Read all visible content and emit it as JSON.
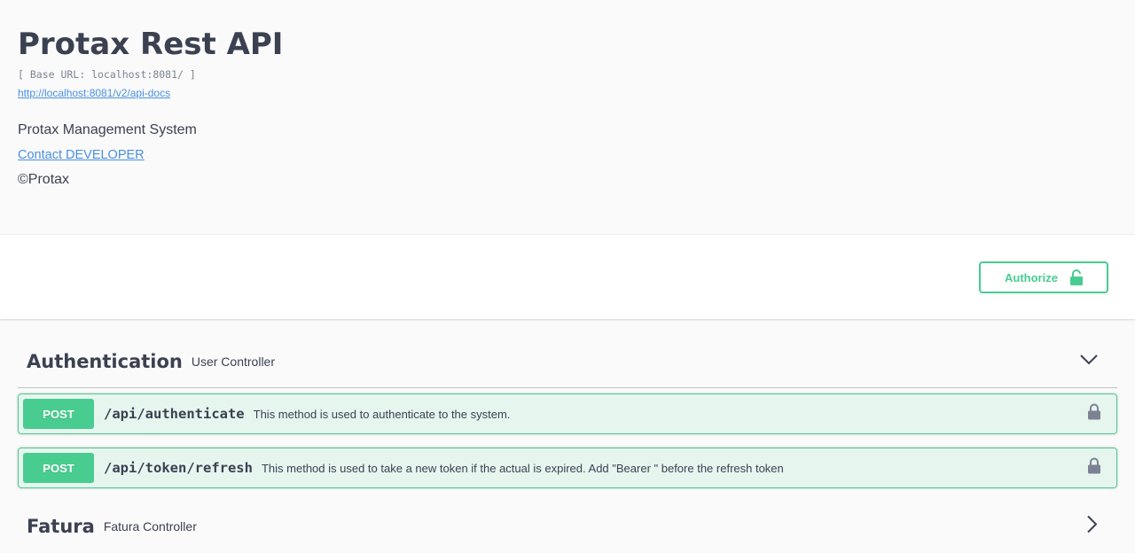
{
  "info": {
    "title": "Protax Rest API",
    "base_url": "[ Base URL: localhost:8081/ ]",
    "docs_link": "http://localhost:8081/v2/api-docs",
    "description": "Protax Management System",
    "contact_link": "Contact DEVELOPER",
    "copyright": "©Protax"
  },
  "scheme_bar": {
    "authorize_label": "Authorize",
    "authorize_icon": "unlocked-padlock-icon"
  },
  "colors": {
    "post_green": "#49cc90",
    "link_blue": "#4990e2",
    "text_dark": "#3b4151"
  },
  "tags": [
    {
      "name": "Authentication",
      "description": "User Controller",
      "expanded": true,
      "arrow_icon": "chevron-down-icon",
      "operations": [
        {
          "method": "POST",
          "path": "/api/authenticate",
          "summary": "This method is used to authenticate to the system.",
          "lock_icon": "lock-icon"
        },
        {
          "method": "POST",
          "path": "/api/token/refresh",
          "summary": "This method is used to take a new token if the actual is expired. Add \"Bearer \" before the refresh token",
          "lock_icon": "lock-icon"
        }
      ]
    },
    {
      "name": "Fatura",
      "description": "Fatura Controller",
      "expanded": false,
      "arrow_icon": "chevron-right-icon"
    }
  ]
}
